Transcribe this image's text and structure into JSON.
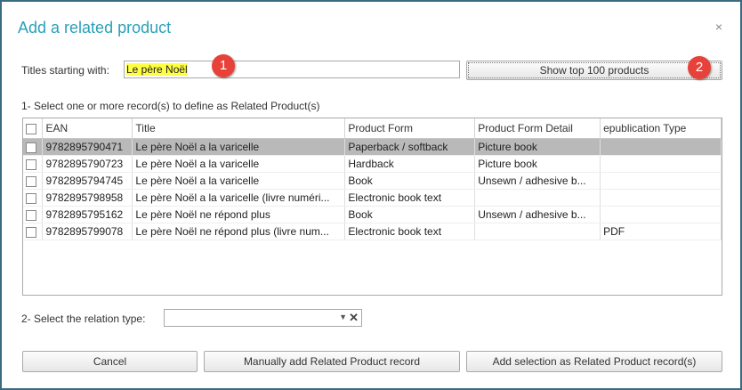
{
  "dialog": {
    "title": "Add a related product",
    "close": "×"
  },
  "search": {
    "label": "Titles starting with:",
    "value": "Le père Noël",
    "button_label": "Show top 100 products"
  },
  "badges": {
    "one": "1",
    "two": "2"
  },
  "section1": {
    "label": "1- Select one or more record(s) to define as Related Product(s)"
  },
  "table": {
    "headers": [
      "EAN",
      "Title",
      "Product Form",
      "Product Form Detail",
      "epublication Type"
    ],
    "rows": [
      {
        "ean": "9782895790471",
        "title": "Le père Noël a la varicelle",
        "form": "Paperback / softback",
        "detail": "Picture book",
        "epub": ""
      },
      {
        "ean": "9782895790723",
        "title": "Le père Noël a la varicelle",
        "form": "Hardback",
        "detail": "Picture book",
        "epub": ""
      },
      {
        "ean": "9782895794745",
        "title": "Le père Noël a la varicelle",
        "form": "Book",
        "detail": "Unsewn / adhesive b...",
        "epub": ""
      },
      {
        "ean": "9782895798958",
        "title": "Le père Noël a la varicelle (livre numéri...",
        "form": "Electronic book text",
        "detail": "",
        "epub": ""
      },
      {
        "ean": "9782895795162",
        "title": "Le père Noël ne répond plus",
        "form": "Book",
        "detail": "Unsewn / adhesive b...",
        "epub": ""
      },
      {
        "ean": "9782895799078",
        "title": "Le père Noël ne répond plus (livre num...",
        "form": "Electronic book text",
        "detail": "",
        "epub": "PDF"
      }
    ]
  },
  "section2": {
    "label": "2- Select the relation type:",
    "value": ""
  },
  "buttons": {
    "cancel": "Cancel",
    "manual": "Manually add Related Product record",
    "add_selection": "Add selection as Related Product record(s)"
  },
  "colors": {
    "title": "#2aa0b8",
    "frame": "#3c6b81",
    "badge": "#e8413a",
    "highlight": "#ffff44",
    "selected_row": "#b9b9b9"
  }
}
